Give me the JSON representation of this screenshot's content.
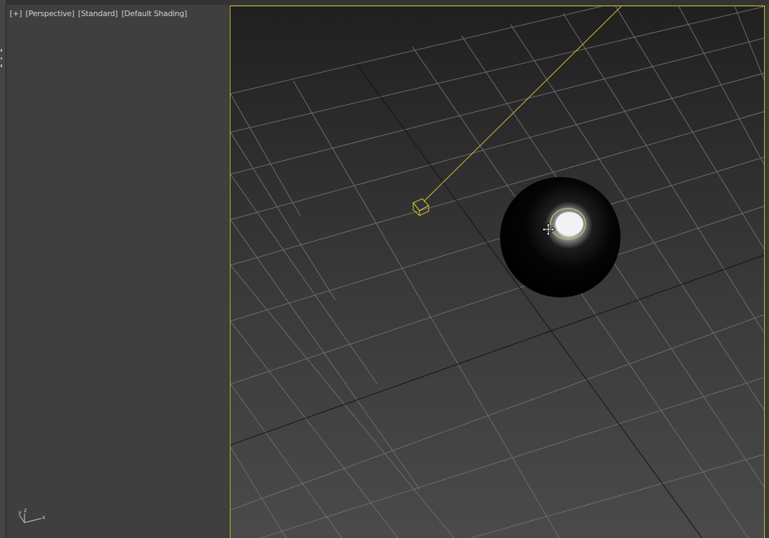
{
  "left_viewport": {
    "label_parts": [
      "[+]",
      "[Perspective]",
      "[Standard]",
      "[Default Shading]"
    ],
    "gizmo_axes": {
      "x": "x",
      "y": "y",
      "z": "z"
    }
  },
  "main_viewport": {
    "active_border_color": "#d7c92a",
    "objects": [
      {
        "name": "spotlight",
        "icon": "cube-wireframe-icon"
      },
      {
        "name": "sphere",
        "icon": "sphere-icon"
      }
    ],
    "cursor": "move-cursor-icon"
  }
}
